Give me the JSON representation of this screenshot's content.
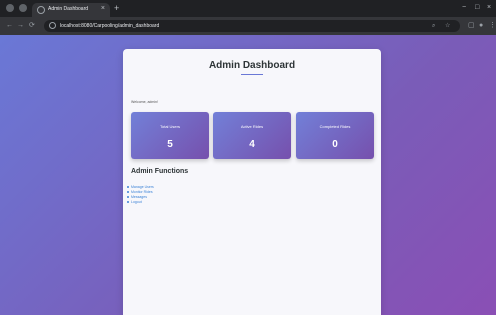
{
  "browser": {
    "tab_title": "Admin Dashboard",
    "new_tab": "+",
    "url": "localhost:8080/Carpooling/admin_dashboard",
    "window_controls": {
      "minimize": "−",
      "maximize": "□",
      "close": "×"
    }
  },
  "page": {
    "title": "Admin Dashboard",
    "welcome_text": "Welcome, admin!",
    "stats": [
      {
        "label": "Total Users",
        "value": "5"
      },
      {
        "label": "Active Rides",
        "value": "4"
      },
      {
        "label": "Completed Rides",
        "value": "0"
      }
    ],
    "functions_title": "Admin Functions",
    "functions": [
      {
        "label": "Manage Users"
      },
      {
        "label": "Monitor Rides"
      },
      {
        "label": "Messages"
      },
      {
        "label": "Logout"
      }
    ]
  },
  "colors": {
    "accent": "#6a78d6",
    "card_start": "#7280d8",
    "card_end": "#7650ad",
    "link": "#3b82d6"
  }
}
